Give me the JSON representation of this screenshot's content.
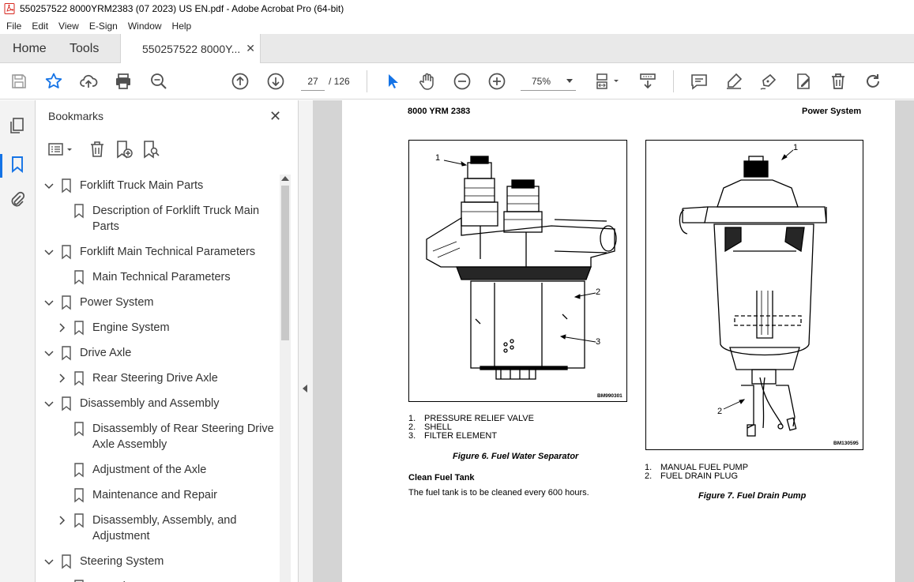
{
  "window": {
    "title": "550257522 8000YRM2383 (07 2023) US EN.pdf - Adobe Acrobat Pro (64-bit)"
  },
  "menu": [
    "File",
    "Edit",
    "View",
    "E-Sign",
    "Window",
    "Help"
  ],
  "tabs": {
    "home": "Home",
    "tools": "Tools",
    "document": "550257522 8000Y..."
  },
  "toolbar": {
    "page_current": "27",
    "page_total": "/ 126",
    "zoom": "75%"
  },
  "bookmarks": {
    "title": "Bookmarks",
    "items": [
      {
        "label": "Forklift Truck Main Parts",
        "level": 0,
        "state": "expanded"
      },
      {
        "label": "Description of Forklift Truck Main",
        "label2": "Parts",
        "level": 1,
        "state": "none"
      },
      {
        "label": "Forklift Main Technical Parameters",
        "level": 0,
        "state": "expanded"
      },
      {
        "label": "Main Technical Parameters",
        "level": 1,
        "state": "none"
      },
      {
        "label": "Power System",
        "level": 0,
        "state": "expanded"
      },
      {
        "label": "Engine System",
        "level": 1,
        "state": "collapsed"
      },
      {
        "label": "Drive Axle",
        "level": 0,
        "state": "expanded"
      },
      {
        "label": "Rear Steering Drive Axle",
        "level": 1,
        "state": "collapsed"
      },
      {
        "label": "Disassembly and Assembly",
        "level": 0,
        "state": "expanded"
      },
      {
        "label": "Disassembly of Rear Steering Drive",
        "label2": "Axle Assembly",
        "level": 1,
        "state": "none"
      },
      {
        "label": "Adjustment of the Axle",
        "level": 1,
        "state": "none"
      },
      {
        "label": "Maintenance and Repair",
        "level": 1,
        "state": "none"
      },
      {
        "label": "Disassembly, Assembly, and",
        "label2": "Adjustment",
        "level": 1,
        "state": "collapsed"
      },
      {
        "label": "Steering System",
        "level": 0,
        "state": "expanded"
      },
      {
        "label": "Overview",
        "level": 1,
        "state": "none"
      }
    ]
  },
  "document": {
    "header_left": "8000 YRM 2383",
    "header_right": "Power System",
    "figure6": {
      "code": "BM990301",
      "callouts": [
        "1",
        "2",
        "3"
      ],
      "legend": [
        {
          "n": "1.",
          "text": "PRESSURE RELIEF VALVE"
        },
        {
          "n": "2.",
          "text": "SHELL"
        },
        {
          "n": "3.",
          "text": "FILTER ELEMENT"
        }
      ],
      "caption": "Figure 6. Fuel Water Separator"
    },
    "figure7": {
      "code": "BM130595",
      "callouts": [
        "1",
        "2"
      ],
      "legend": [
        {
          "n": "1.",
          "text": "MANUAL FUEL PUMP"
        },
        {
          "n": "2.",
          "text": "FUEL DRAIN PLUG"
        }
      ],
      "caption": "Figure 7. Fuel Drain Pump"
    },
    "section_title": "Clean Fuel Tank",
    "section_text": "The fuel tank is to be cleaned every 600 hours."
  },
  "colors": {
    "accent": "#1473e6",
    "pdf_red": "#d7261e",
    "icon_gray": "#505050"
  }
}
